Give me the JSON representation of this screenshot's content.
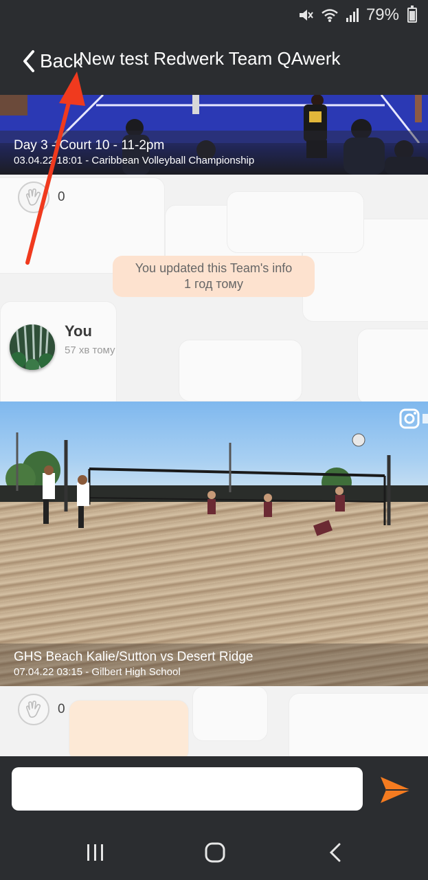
{
  "status_bar": {
    "battery_percent": "79%"
  },
  "header": {
    "back_label": "Back",
    "title": "New test Redwerk Team QAwerk"
  },
  "posts": [
    {
      "title": "Day 3 - Court 10 - 11-2pm",
      "subtitle": "03.04.22 18:01 - Caribbean Volleyball Championship",
      "likes": "0"
    },
    {
      "title": "GHS Beach Kalie/Sutton vs Desert Ridge",
      "subtitle": "07.04.22 03:15 - Gilbert High School",
      "likes": "0"
    }
  ],
  "system_message": {
    "line1": "You updated this Team's info",
    "line2": "1 год тому"
  },
  "author": {
    "name": "You",
    "time": "57 хв тому"
  },
  "composer": {
    "value": "",
    "placeholder": ""
  },
  "colors": {
    "accent": "#f47b20",
    "annotation": "#f03a1e",
    "pill": "#fde2cf"
  }
}
